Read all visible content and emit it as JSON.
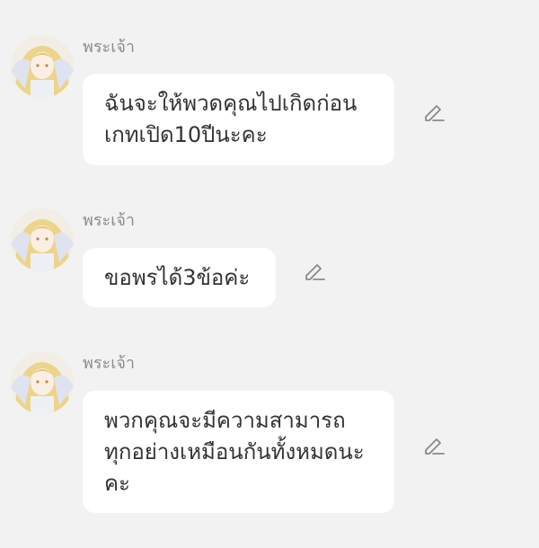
{
  "messages": [
    {
      "sender": "พระเจ้า",
      "text": "ฉันจะให้พวดคุณไปเกิดก่อน\nเกทเปิด10ปีนะคะ",
      "avatar_icon": "goddess-avatar",
      "edit_icon": "pencil-icon"
    },
    {
      "sender": "พระเจ้า",
      "text": "ขอพรได้3ข้อค่ะ",
      "avatar_icon": "goddess-avatar",
      "edit_icon": "pencil-icon"
    },
    {
      "sender": "พระเจ้า",
      "text": "พวกคุณจะมีความสามารถ\nทุกอย่างเหมือนกันทั้งหมดนะ\nคะ",
      "avatar_icon": "goddess-avatar",
      "edit_icon": "pencil-icon"
    }
  ],
  "colors": {
    "background": "#f2f2f3",
    "bubble": "#ffffff",
    "text": "#333333",
    "sender": "#8c8c8c",
    "icon": "#8a8a8a"
  }
}
